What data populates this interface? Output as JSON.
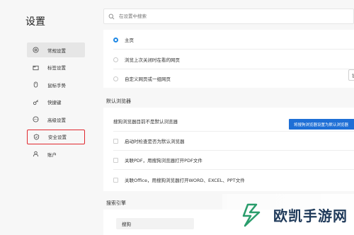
{
  "page": {
    "title": "设置"
  },
  "search": {
    "placeholder": "在设置中搜索"
  },
  "sidebar": {
    "items": [
      {
        "label": "常规设置",
        "icon": "settings-icon",
        "active": true
      },
      {
        "label": "标签设置",
        "icon": "tab-icon"
      },
      {
        "label": "鼠标手势",
        "icon": "mouse-gesture-icon"
      },
      {
        "label": "快捷键",
        "icon": "shortcut-key-icon"
      },
      {
        "label": "高级设置",
        "icon": "more-icon"
      },
      {
        "label": "安全设置",
        "icon": "shield-icon",
        "highlighted": true
      },
      {
        "label": "账户",
        "icon": "person-icon"
      }
    ]
  },
  "startup": {
    "options": [
      "主页",
      "浏览上次关闭时在看的网页",
      "自定义网页或一组网页"
    ],
    "selected_index": 0,
    "set_button": "设"
  },
  "default_browser": {
    "section_label": "默认浏览器",
    "status": "搜狗浏览器目前不是默认浏览器",
    "button": "将搜狗浏览器设置为默认浏览器",
    "checks": [
      "启动时检查是否为默认浏览器",
      "关联PDF，用搜狗浏览器打开PDF文件",
      "关联Office，用搜狗浏览器打开WORD、EXCEL、PPT文件"
    ]
  },
  "search_engine": {
    "section_label": "搜索引擎",
    "selected": "搜狗"
  },
  "watermark": {
    "text": "欧凯手游网"
  },
  "colors": {
    "accent": "#1e6fd6",
    "highlight": "#e0282e"
  }
}
